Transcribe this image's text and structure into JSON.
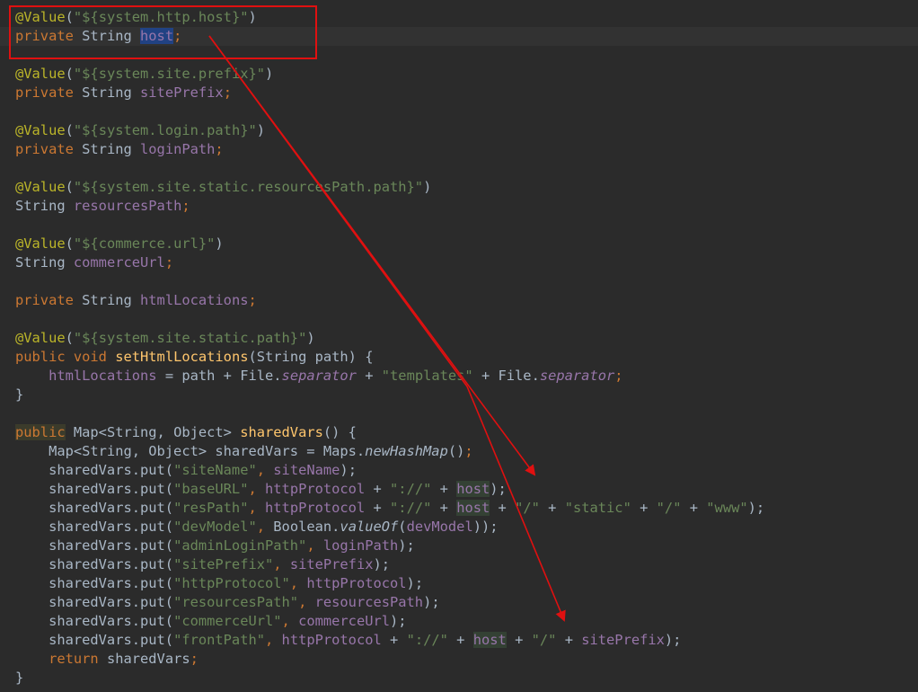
{
  "editor": {
    "language": "java",
    "theme": "darcula",
    "highlight_box_color": "#e01010",
    "arrow_color": "#e01010",
    "lines": [
      [
        {
          "t": "@Value",
          "c": "ann"
        },
        {
          "t": "(",
          "c": "plain"
        },
        {
          "t": "\"${system.http.host}\"",
          "c": "str"
        },
        {
          "t": ")",
          "c": "plain"
        }
      ],
      [
        {
          "t": "private ",
          "c": "kw"
        },
        {
          "t": "String ",
          "c": "plain"
        },
        {
          "t": "host",
          "c": "field-sel"
        },
        {
          "t": ";",
          "c": "punc"
        }
      ],
      [],
      [
        {
          "t": "@Value",
          "c": "ann"
        },
        {
          "t": "(",
          "c": "plain"
        },
        {
          "t": "\"${system.site.prefix}\"",
          "c": "str"
        },
        {
          "t": ")",
          "c": "plain"
        }
      ],
      [
        {
          "t": "private ",
          "c": "kw"
        },
        {
          "t": "String ",
          "c": "plain"
        },
        {
          "t": "sitePrefix",
          "c": "field"
        },
        {
          "t": ";",
          "c": "punc"
        }
      ],
      [],
      [
        {
          "t": "@Value",
          "c": "ann"
        },
        {
          "t": "(",
          "c": "plain"
        },
        {
          "t": "\"${system.login.path}\"",
          "c": "str"
        },
        {
          "t": ")",
          "c": "plain"
        }
      ],
      [
        {
          "t": "private ",
          "c": "kw"
        },
        {
          "t": "String ",
          "c": "plain"
        },
        {
          "t": "loginPath",
          "c": "field"
        },
        {
          "t": ";",
          "c": "punc"
        }
      ],
      [],
      [
        {
          "t": "@Value",
          "c": "ann"
        },
        {
          "t": "(",
          "c": "plain"
        },
        {
          "t": "\"${system.site.static.resourcesPath.path}\"",
          "c": "str"
        },
        {
          "t": ")",
          "c": "plain"
        }
      ],
      [
        {
          "t": "String ",
          "c": "plain"
        },
        {
          "t": "resourcesPath",
          "c": "field"
        },
        {
          "t": ";",
          "c": "punc"
        }
      ],
      [],
      [
        {
          "t": "@Value",
          "c": "ann"
        },
        {
          "t": "(",
          "c": "plain"
        },
        {
          "t": "\"${commerce.url}\"",
          "c": "str"
        },
        {
          "t": ")",
          "c": "plain"
        }
      ],
      [
        {
          "t": "String ",
          "c": "plain"
        },
        {
          "t": "commerceUrl",
          "c": "field"
        },
        {
          "t": ";",
          "c": "punc"
        }
      ],
      [],
      [
        {
          "t": "private ",
          "c": "kw"
        },
        {
          "t": "String ",
          "c": "plain"
        },
        {
          "t": "htmlLocations",
          "c": "field"
        },
        {
          "t": ";",
          "c": "punc"
        }
      ],
      [],
      [
        {
          "t": "@Value",
          "c": "ann"
        },
        {
          "t": "(",
          "c": "plain"
        },
        {
          "t": "\"${system.site.static.path}\"",
          "c": "str"
        },
        {
          "t": ")",
          "c": "plain"
        }
      ],
      [
        {
          "t": "public ",
          "c": "kw"
        },
        {
          "t": "void ",
          "c": "kw"
        },
        {
          "t": "setHtmlLocations",
          "c": "fn"
        },
        {
          "t": "(String path) {",
          "c": "plain"
        }
      ],
      [
        {
          "t": "    ",
          "c": "plain"
        },
        {
          "t": "htmlLocations",
          "c": "field"
        },
        {
          "t": " = path + File.",
          "c": "plain"
        },
        {
          "t": "separator",
          "c": "static"
        },
        {
          "t": " + ",
          "c": "plain"
        },
        {
          "t": "\"templates\"",
          "c": "str"
        },
        {
          "t": " + File.",
          "c": "plain"
        },
        {
          "t": "separator",
          "c": "static"
        },
        {
          "t": ";",
          "c": "punc"
        }
      ],
      [
        {
          "t": "}",
          "c": "plain"
        }
      ],
      [],
      [
        {
          "t": "public",
          "c": "kw-hl"
        },
        {
          "t": " Map<String, Object> ",
          "c": "plain"
        },
        {
          "t": "sharedVars",
          "c": "fn"
        },
        {
          "t": "() {",
          "c": "plain"
        }
      ],
      [
        {
          "t": "    Map<String, Object> sharedVars = Maps.",
          "c": "plain"
        },
        {
          "t": "newHashMap",
          "c": "italic"
        },
        {
          "t": "()",
          "c": "plain"
        },
        {
          "t": ";",
          "c": "punc"
        }
      ],
      [
        {
          "t": "    sharedVars.put(",
          "c": "plain"
        },
        {
          "t": "\"siteName\"",
          "c": "str"
        },
        {
          "t": ", ",
          "c": "punc"
        },
        {
          "t": "siteName",
          "c": "field"
        },
        {
          "t": ");",
          "c": "plain"
        }
      ],
      [
        {
          "t": "    sharedVars.put(",
          "c": "plain"
        },
        {
          "t": "\"baseURL\"",
          "c": "str"
        },
        {
          "t": ", ",
          "c": "punc"
        },
        {
          "t": "httpProtocol",
          "c": "field"
        },
        {
          "t": " + ",
          "c": "plain"
        },
        {
          "t": "\"://\"",
          "c": "str"
        },
        {
          "t": " + ",
          "c": "plain"
        },
        {
          "t": "host",
          "c": "field-ref"
        },
        {
          "t": ");",
          "c": "plain"
        }
      ],
      [
        {
          "t": "    sharedVars.put(",
          "c": "plain"
        },
        {
          "t": "\"resPath\"",
          "c": "str"
        },
        {
          "t": ", ",
          "c": "punc"
        },
        {
          "t": "httpProtocol",
          "c": "field"
        },
        {
          "t": " + ",
          "c": "plain"
        },
        {
          "t": "\"://\"",
          "c": "str"
        },
        {
          "t": " + ",
          "c": "plain"
        },
        {
          "t": "host",
          "c": "field-ref"
        },
        {
          "t": " + ",
          "c": "plain"
        },
        {
          "t": "\"/\"",
          "c": "str"
        },
        {
          "t": " + ",
          "c": "plain"
        },
        {
          "t": "\"static\"",
          "c": "str"
        },
        {
          "t": " + ",
          "c": "plain"
        },
        {
          "t": "\"/\"",
          "c": "str"
        },
        {
          "t": " + ",
          "c": "plain"
        },
        {
          "t": "\"www\"",
          "c": "str"
        },
        {
          "t": ");",
          "c": "plain"
        }
      ],
      [
        {
          "t": "    sharedVars.put(",
          "c": "plain"
        },
        {
          "t": "\"devModel\"",
          "c": "str"
        },
        {
          "t": ", ",
          "c": "punc"
        },
        {
          "t": "Boolean.",
          "c": "plain"
        },
        {
          "t": "valueOf",
          "c": "italic"
        },
        {
          "t": "(",
          "c": "plain"
        },
        {
          "t": "devModel",
          "c": "field"
        },
        {
          "t": "));",
          "c": "plain"
        }
      ],
      [
        {
          "t": "    sharedVars.put(",
          "c": "plain"
        },
        {
          "t": "\"adminLoginPath\"",
          "c": "str"
        },
        {
          "t": ", ",
          "c": "punc"
        },
        {
          "t": "loginPath",
          "c": "field"
        },
        {
          "t": ");",
          "c": "plain"
        }
      ],
      [
        {
          "t": "    sharedVars.put(",
          "c": "plain"
        },
        {
          "t": "\"sitePrefix\"",
          "c": "str"
        },
        {
          "t": ", ",
          "c": "punc"
        },
        {
          "t": "sitePrefix",
          "c": "field"
        },
        {
          "t": ");",
          "c": "plain"
        }
      ],
      [
        {
          "t": "    sharedVars.put(",
          "c": "plain"
        },
        {
          "t": "\"httpProtocol\"",
          "c": "str"
        },
        {
          "t": ", ",
          "c": "punc"
        },
        {
          "t": "httpProtocol",
          "c": "field"
        },
        {
          "t": ");",
          "c": "plain"
        }
      ],
      [
        {
          "t": "    sharedVars.put(",
          "c": "plain"
        },
        {
          "t": "\"resourcesPath\"",
          "c": "str"
        },
        {
          "t": ", ",
          "c": "punc"
        },
        {
          "t": "resourcesPath",
          "c": "field"
        },
        {
          "t": ");",
          "c": "plain"
        }
      ],
      [
        {
          "t": "    sharedVars.put(",
          "c": "plain"
        },
        {
          "t": "\"commerceUrl\"",
          "c": "str"
        },
        {
          "t": ", ",
          "c": "punc"
        },
        {
          "t": "commerceUrl",
          "c": "field"
        },
        {
          "t": ");",
          "c": "plain"
        }
      ],
      [
        {
          "t": "    sharedVars.put(",
          "c": "plain"
        },
        {
          "t": "\"frontPath\"",
          "c": "str"
        },
        {
          "t": ", ",
          "c": "punc"
        },
        {
          "t": "httpProtocol",
          "c": "field"
        },
        {
          "t": " + ",
          "c": "plain"
        },
        {
          "t": "\"://\"",
          "c": "str"
        },
        {
          "t": " + ",
          "c": "plain"
        },
        {
          "t": "host",
          "c": "field-ref"
        },
        {
          "t": " + ",
          "c": "plain"
        },
        {
          "t": "\"/\"",
          "c": "str"
        },
        {
          "t": " + ",
          "c": "plain"
        },
        {
          "t": "sitePrefix",
          "c": "field"
        },
        {
          "t": ");",
          "c": "plain"
        }
      ],
      [
        {
          "t": "    ",
          "c": "plain"
        },
        {
          "t": "return ",
          "c": "kw"
        },
        {
          "t": "sharedVars",
          "c": "plain"
        },
        {
          "t": ";",
          "c": "punc"
        }
      ],
      [
        {
          "t": "}",
          "c": "plain"
        }
      ]
    ]
  }
}
